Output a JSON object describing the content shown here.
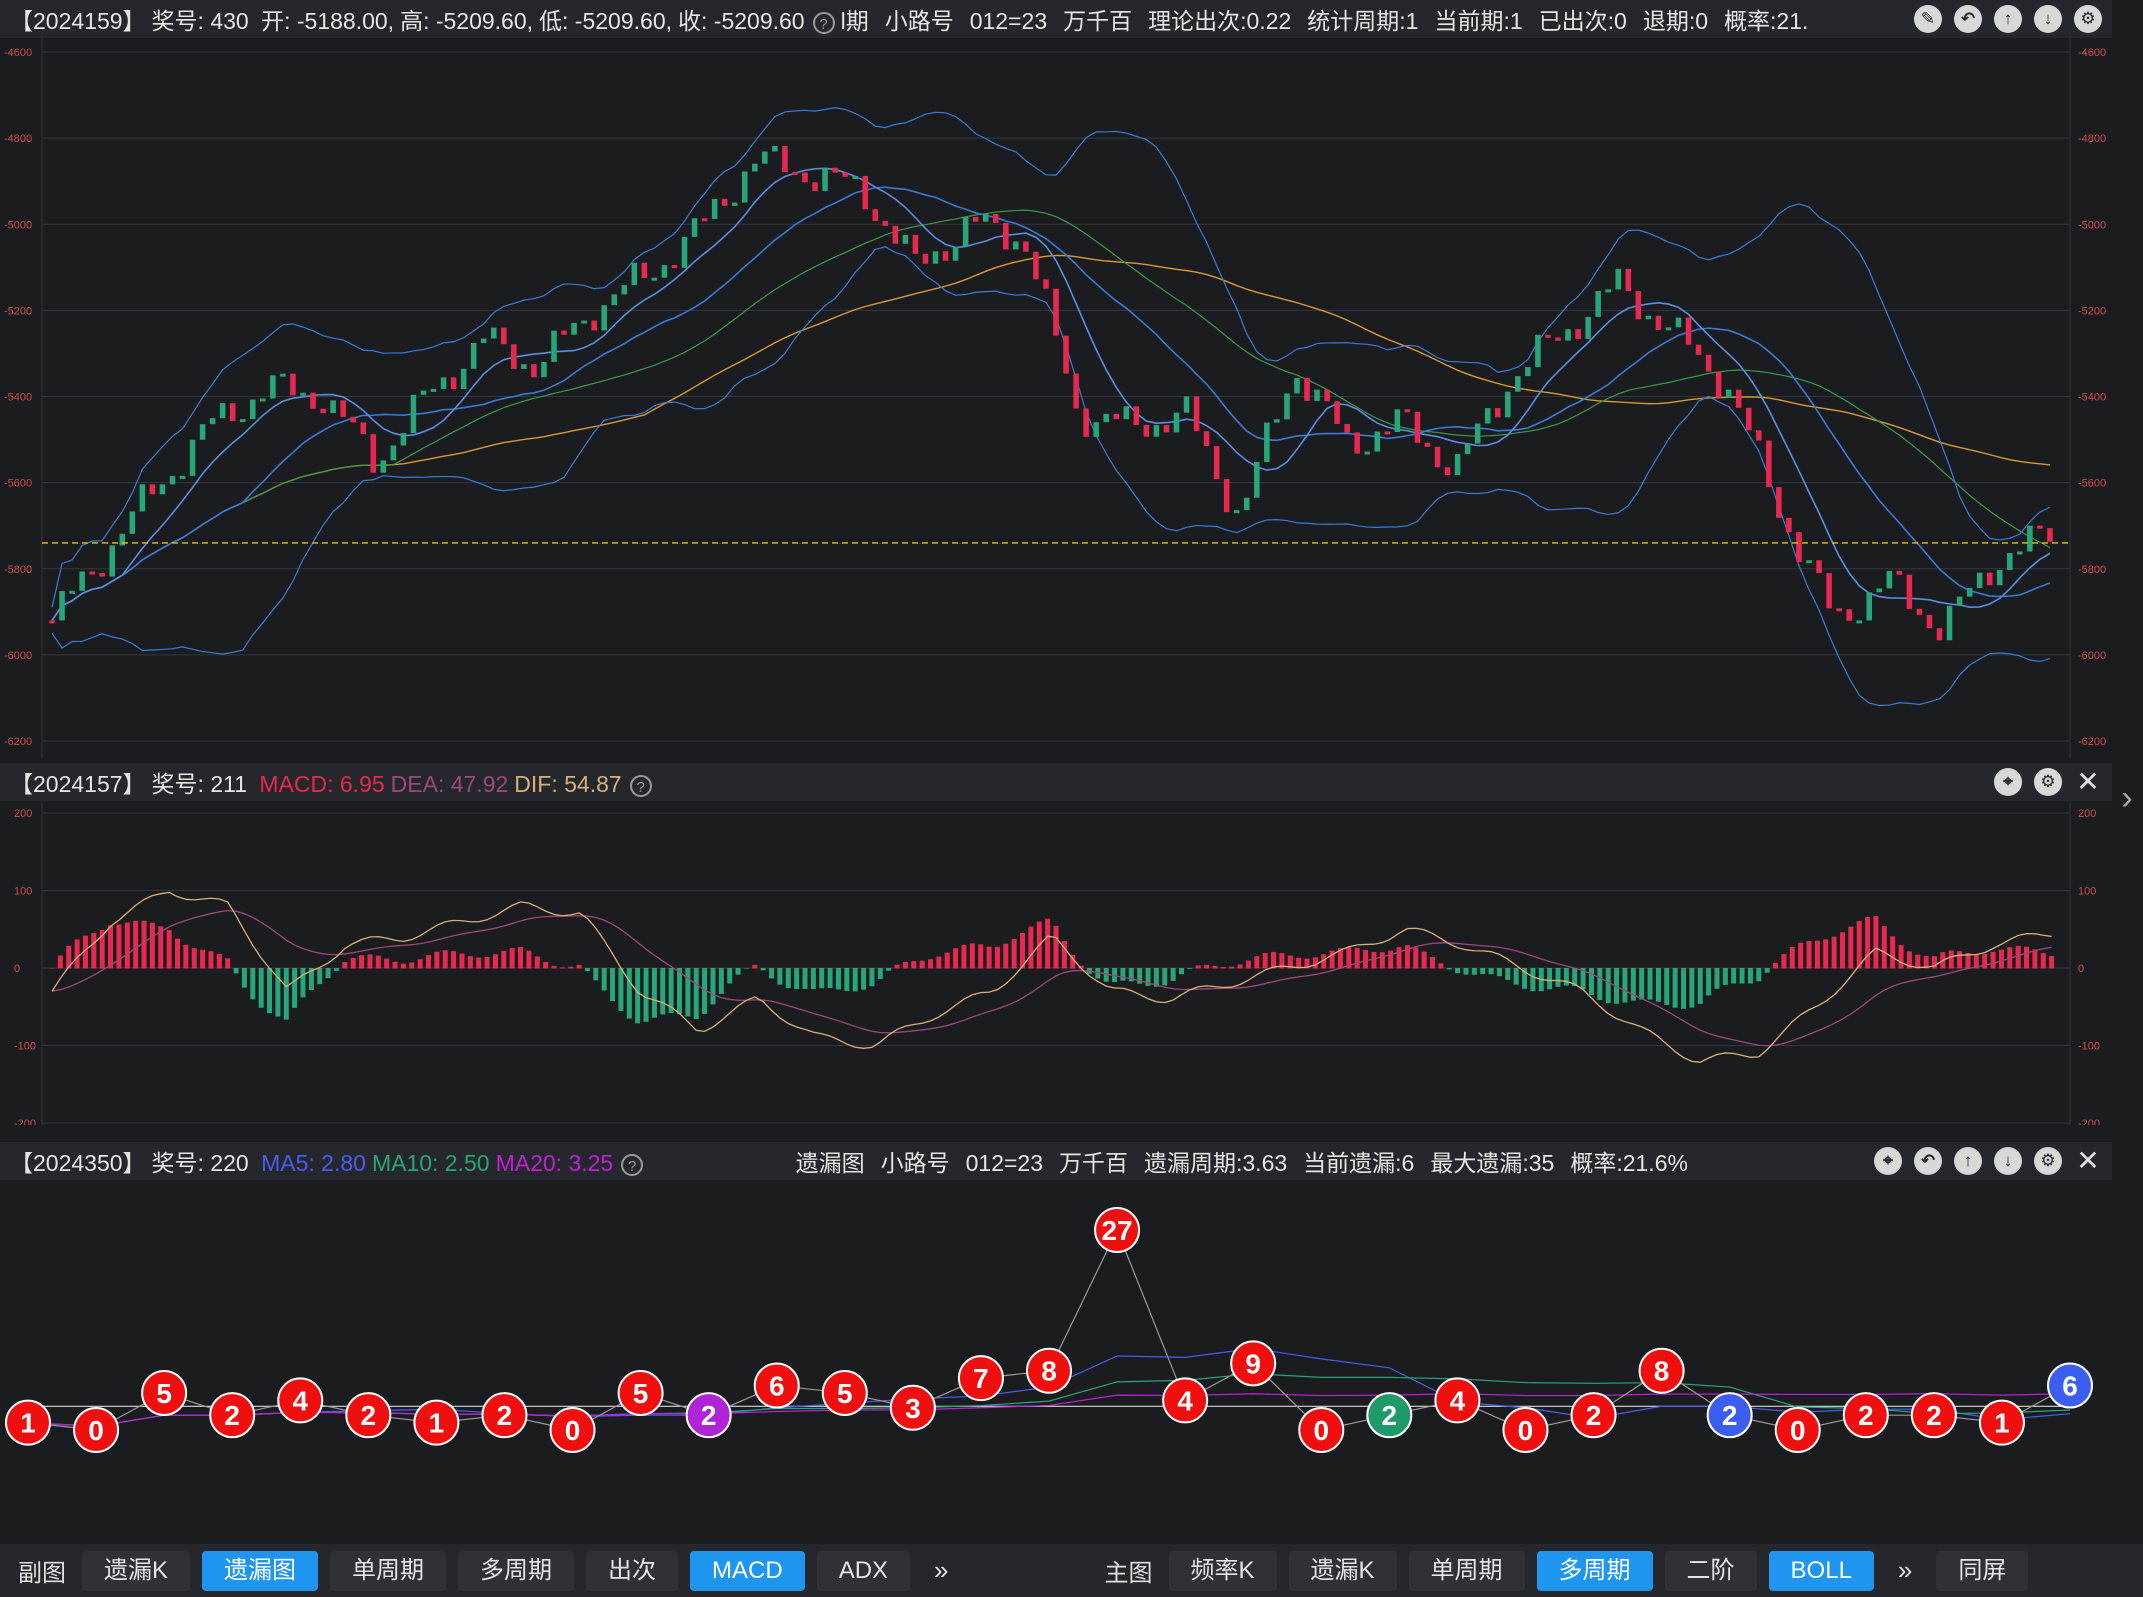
{
  "colors": {
    "up": "#e8294f",
    "down": "#27a67a",
    "boll": "#3a7bd5",
    "ma_green": "#3a9a48",
    "ma_orange": "#d89a30",
    "price_line": "#e0c020",
    "grid": "#34363d",
    "axis_text": "#d24a4a"
  },
  "main": {
    "header": {
      "id": "【2024159】",
      "prize": "奖号: 430",
      "open": "开: -5188.00,",
      "high": "高: -5209.60,",
      "low": "低: -5209.60,",
      "close": "收: -5209.60",
      "period_tail": "l期",
      "road": "小路号",
      "code": "012=23",
      "digits": "万千百",
      "theory": "理论出次:0.22",
      "stat": "统计周期:1",
      "current": "当前期:1",
      "hit": "已出次:0",
      "retreat": "退期:0",
      "prob": "概率:21."
    },
    "ticks": [
      "-4600",
      "-4800",
      "-5000",
      "-5200",
      "-5400",
      "-5600",
      "-5800",
      "-6000",
      "-6200"
    ]
  },
  "macd": {
    "header": {
      "id": "【2024157】",
      "prize": "奖号: 211",
      "macd": "MACD: 6.95",
      "dea": "DEA: 47.92",
      "dif": "DIF: 54.87"
    },
    "ticks": [
      "200",
      "100",
      "0",
      "-100",
      "-200"
    ]
  },
  "miss": {
    "header": {
      "id": "【2024350】",
      "prize": "奖号: 220",
      "ma5": "MA5: 2.80",
      "ma10": "MA10: 2.50",
      "ma20": "MA20: 3.25",
      "title": "遗漏图",
      "road": "小路号",
      "code": "012=23",
      "digits": "万千百",
      "period": "遗漏周期:3.63",
      "cur": "当前遗漏:6",
      "max": "最大遗漏:35",
      "prob": "概率:21.6%"
    }
  },
  "chart_data": [
    {
      "type": "line",
      "title": "",
      "ylim": [
        -6200,
        -4600
      ],
      "y_ticks": [
        -4600,
        -4800,
        -5000,
        -5200,
        -5400,
        -5600,
        -5800,
        -6000,
        -6200
      ],
      "close_anchors": [
        -5920,
        -5760,
        -5600,
        -5460,
        -5380,
        -5400,
        -5550,
        -5390,
        -5270,
        -5330,
        -5200,
        -5120,
        -5010,
        -4850,
        -4880,
        -4920,
        -5100,
        -5000,
        -5030,
        -5440,
        -5470,
        -5440,
        -5680,
        -5330,
        -5510,
        -5460,
        -5570,
        -5360,
        -5250,
        -5140,
        -5250,
        -5370,
        -5660,
        -5920,
        -5830,
        -5940,
        -5780,
        -5720
      ],
      "current_price": -5740,
      "series": [
        {
          "name": "BOLL",
          "values": "bands"
        }
      ]
    },
    {
      "type": "bar",
      "ylim": [
        -200,
        200
      ],
      "y_ticks": [
        200,
        100,
        0,
        -100,
        -200
      ],
      "series": [
        {
          "name": "MACD",
          "last": 6.95
        },
        {
          "name": "DEA",
          "last": 47.92
        },
        {
          "name": "DIF",
          "last": 54.87
        }
      ]
    },
    {
      "type": "scatter",
      "title": "遗漏图",
      "values": [
        1,
        0,
        5,
        2,
        4,
        2,
        1,
        2,
        0,
        5,
        2,
        6,
        5,
        3,
        7,
        8,
        27,
        4,
        9,
        0,
        2,
        4,
        0,
        2,
        8,
        2,
        0,
        2,
        2,
        1,
        6
      ],
      "point_colors": [
        "red",
        "red",
        "red",
        "red",
        "red",
        "red",
        "red",
        "red",
        "red",
        "red",
        "purple",
        "red",
        "red",
        "red",
        "red",
        "red",
        "red",
        "red",
        "red",
        "red",
        "green",
        "red",
        "red",
        "red",
        "red",
        "blue",
        "red",
        "red",
        "red",
        "red",
        "blue"
      ],
      "series": [
        {
          "name": "MA5",
          "last": 2.8
        },
        {
          "name": "MA10",
          "last": 2.5
        },
        {
          "name": "MA20",
          "last": 3.25
        }
      ]
    }
  ],
  "bottom": {
    "sub_label": "副图",
    "sub_buttons": [
      "遗漏K",
      "遗漏图",
      "单周期",
      "多周期",
      "出次",
      "MACD",
      "ADX"
    ],
    "sub_active": [
      1,
      5
    ],
    "more": "»",
    "main_label": "主图",
    "main_buttons": [
      "频率K",
      "遗漏K",
      "单周期",
      "多周期",
      "二阶",
      "BOLL"
    ],
    "main_active": [
      3,
      5
    ],
    "split": "同屏"
  }
}
